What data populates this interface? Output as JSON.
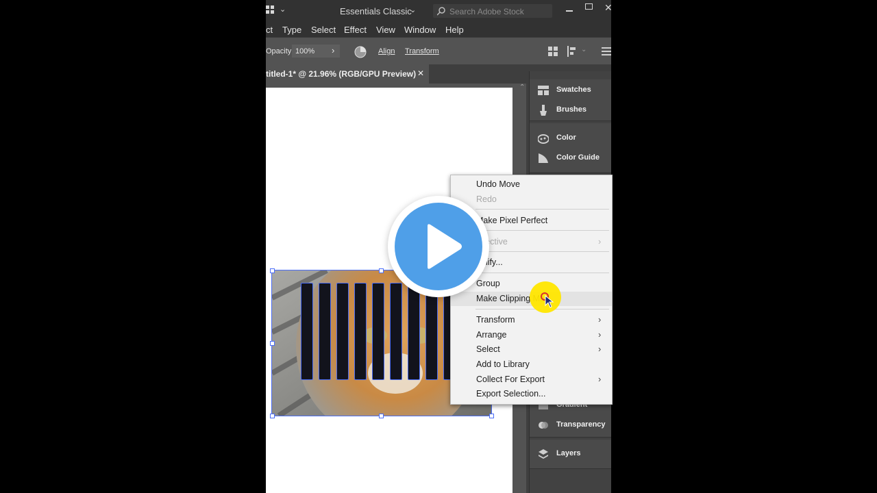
{
  "titlebar": {
    "workspace": "Essentials Classic",
    "search_placeholder": "Search Adobe Stock"
  },
  "menubar": {
    "items": [
      "ct",
      "Type",
      "Select",
      "Effect",
      "View",
      "Window",
      "Help"
    ]
  },
  "controlbar": {
    "opacity_label": "Opacity:",
    "opacity_value": "100%",
    "align_label": "Align",
    "transform_label": "Transform"
  },
  "document_tab": {
    "title": "titled-1* @ 21.96% (RGB/GPU Preview)",
    "close_glyph": "✕"
  },
  "panels": {
    "items": [
      {
        "label": "Swatches",
        "icon": "swatches-icon"
      },
      {
        "label": "Brushes",
        "icon": "brushes-icon"
      },
      {
        "label": "Color",
        "icon": "color-icon"
      },
      {
        "label": "Color Guide",
        "icon": "color-guide-icon"
      },
      {
        "label": "Gradient",
        "icon": "gradient-icon"
      },
      {
        "label": "Transparency",
        "icon": "transparency-icon"
      },
      {
        "label": "Layers",
        "icon": "layers-icon"
      }
    ]
  },
  "context_menu": {
    "items": [
      {
        "label": "Undo Move",
        "enabled": true,
        "submenu": false
      },
      {
        "label": "Redo",
        "enabled": false,
        "submenu": false
      },
      {
        "label": "Make Pixel Perfect",
        "enabled": true,
        "submenu": false
      },
      {
        "label": "spective",
        "enabled": false,
        "submenu": true
      },
      {
        "label": "nplify...",
        "enabled": true,
        "submenu": false
      },
      {
        "label": "Group",
        "enabled": true,
        "submenu": false
      },
      {
        "label": "Make Clipping Ma",
        "enabled": true,
        "submenu": false,
        "hovered": true
      },
      {
        "label": "Transform",
        "enabled": true,
        "submenu": true
      },
      {
        "label": "Arrange",
        "enabled": true,
        "submenu": true
      },
      {
        "label": "Select",
        "enabled": true,
        "submenu": true
      },
      {
        "label": "Add to Library",
        "enabled": true,
        "submenu": false
      },
      {
        "label": "Collect For Export",
        "enabled": true,
        "submenu": true
      },
      {
        "label": "Export Selection...",
        "enabled": true,
        "submenu": false
      }
    ],
    "submenu_arrow": "›"
  },
  "colors": {
    "app_bg": "#535353",
    "chrome_bg": "#323232",
    "selection": "#4a6cf7",
    "play_button": "#4f9fe8",
    "cursor_highlight": "#ffe600"
  }
}
